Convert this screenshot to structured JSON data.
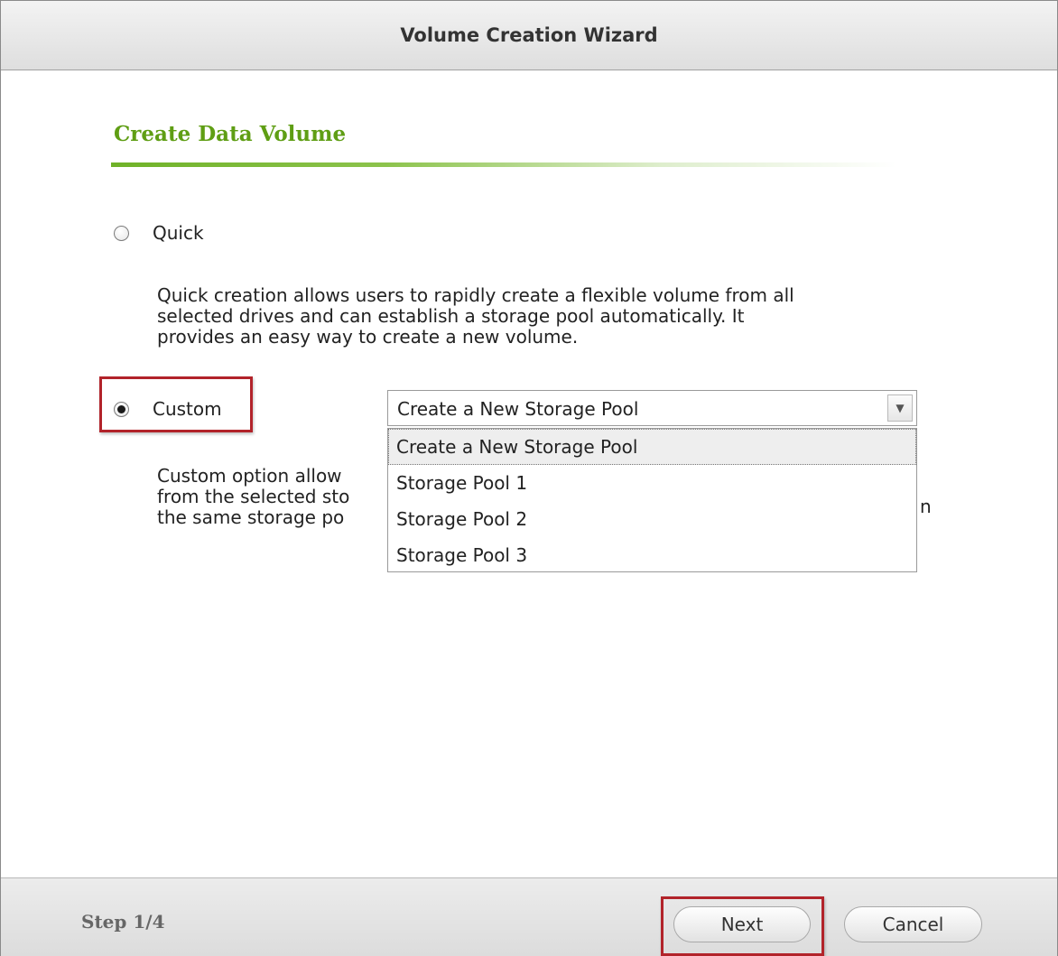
{
  "window": {
    "title": "Volume Creation Wizard"
  },
  "section": {
    "title": "Create Data Volume"
  },
  "options": {
    "quick": {
      "label": "Quick",
      "selected": false,
      "description_lines": [
        "Quick creation allows users to rapidly create a flexible volume from all",
        "selected drives and can establish a storage pool automatically. It",
        "provides an easy way to create a new volume."
      ]
    },
    "custom": {
      "label": "Custom",
      "selected": true,
      "description_fragments": [
        "Custom option allow",
        "from the selected sto",
        "the same storage po",
        "n"
      ]
    }
  },
  "pool_select": {
    "value": "Create a New Storage Pool",
    "expanded": true,
    "options": [
      "Create a New Storage Pool",
      "Storage Pool 1",
      "Storage Pool 2",
      "Storage Pool 3"
    ],
    "highlighted_option": "Create a New Storage Pool"
  },
  "footer": {
    "step": "Step 1/4",
    "next_label": "Next",
    "cancel_label": "Cancel"
  },
  "colors": {
    "accent_green": "#5f9e14",
    "highlight_red": "#b2232a"
  },
  "icons": {
    "dropdown_arrow": "chevron-down-icon"
  }
}
